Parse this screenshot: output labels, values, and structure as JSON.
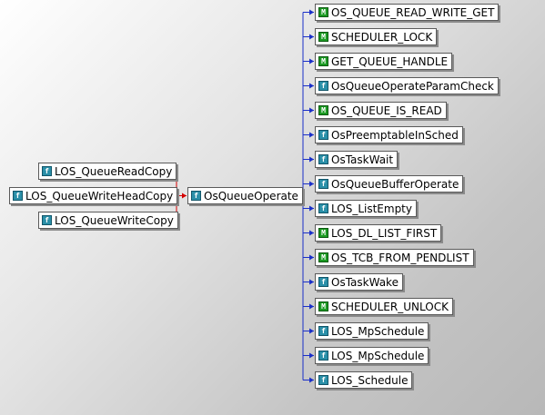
{
  "callers": [
    {
      "label": "LOS_QueueReadCopy",
      "icon": "function-icon"
    },
    {
      "label": "LOS_QueueWriteHeadCopy",
      "icon": "function-icon"
    },
    {
      "label": "LOS_QueueWriteCopy",
      "icon": "function-icon"
    }
  ],
  "center": {
    "label": "OsQueueOperate",
    "icon": "function-icon"
  },
  "callees": [
    {
      "label": "OS_QUEUE_READ_WRITE_GET",
      "icon": "macro-icon"
    },
    {
      "label": "SCHEDULER_LOCK",
      "icon": "macro-icon"
    },
    {
      "label": "GET_QUEUE_HANDLE",
      "icon": "macro-icon"
    },
    {
      "label": "OsQueueOperateParamCheck",
      "icon": "function-icon"
    },
    {
      "label": "OS_QUEUE_IS_READ",
      "icon": "macro-icon"
    },
    {
      "label": "OsPreemptableInSched",
      "icon": "function-icon"
    },
    {
      "label": "OsTaskWait",
      "icon": "function-icon"
    },
    {
      "label": "OsQueueBufferOperate",
      "icon": "function-icon"
    },
    {
      "label": "LOS_ListEmpty",
      "icon": "function-icon"
    },
    {
      "label": "LOS_DL_LIST_FIRST",
      "icon": "macro-icon"
    },
    {
      "label": "OS_TCB_FROM_PENDLIST",
      "icon": "macro-icon"
    },
    {
      "label": "OsTaskWake",
      "icon": "function-icon"
    },
    {
      "label": "SCHEDULER_UNLOCK",
      "icon": "macro-icon"
    },
    {
      "label": "LOS_MpSchedule",
      "icon": "function-icon"
    },
    {
      "label": "LOS_MpSchedule",
      "icon": "function-icon"
    },
    {
      "label": "LOS_Schedule",
      "icon": "function-icon"
    }
  ],
  "colors": {
    "caller_edge": "#d40000",
    "callee_edge": "#1a2fc8",
    "function_icon": "#2a8fa8",
    "macro_icon": "#1c9a23"
  }
}
